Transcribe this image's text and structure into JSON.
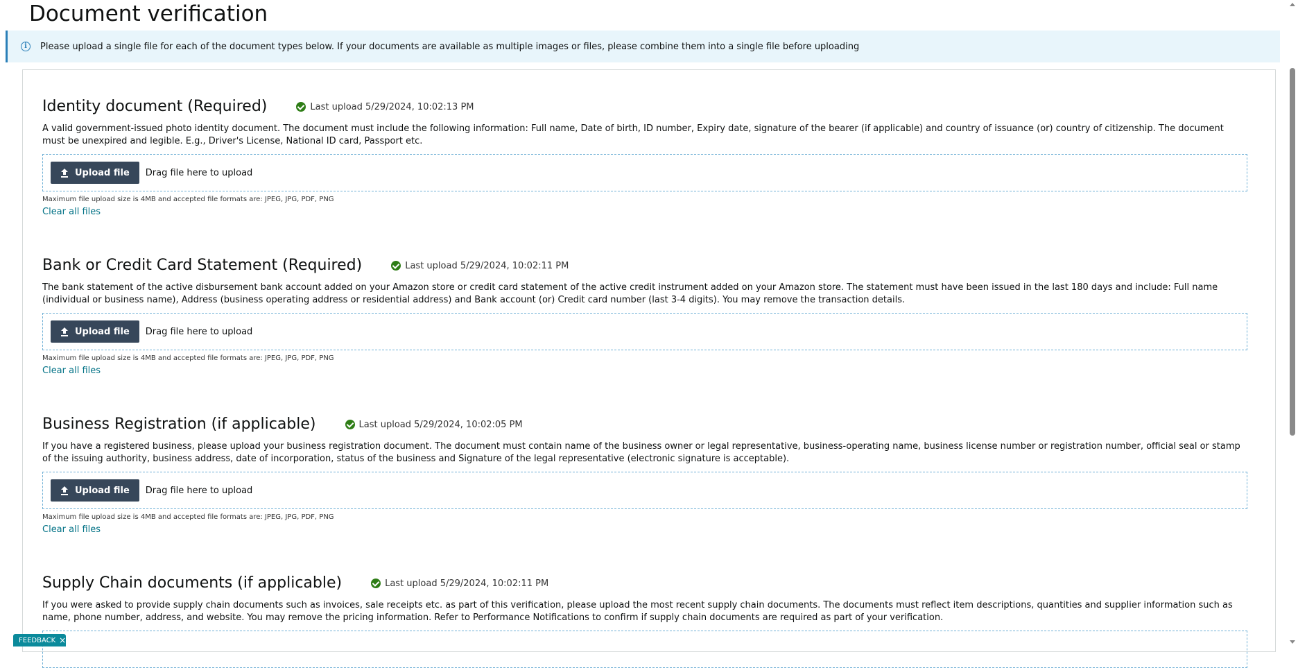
{
  "page": {
    "title": "Document verification"
  },
  "banner": {
    "text": "Please upload a single file for each of the document types below. If your documents are available as multiple images or files, please combine them into a single file before uploading"
  },
  "sections": [
    {
      "title": "Identity document (Required)",
      "status": "Last upload 5/29/2024, 10:02:13 PM",
      "description": "A valid government-issued photo identity document. The document must include the following information: Full name, Date of birth, ID number, Expiry date, signature of the bearer (if applicable) and country of issuance (or) country of citizenship. The document must be unexpired and legible. E.g., Driver's License, National ID card, Passport etc.",
      "upload_label": "Upload file",
      "drag_text": "Drag file here to upload",
      "hint": "Maximum file upload size is 4MB and accepted file formats are: JPEG, JPG, PDF, PNG",
      "clear_label": "Clear all files"
    },
    {
      "title": "Bank or Credit Card Statement (Required)",
      "status": "Last upload 5/29/2024, 10:02:11 PM",
      "description": "The bank statement of the active disbursement bank account added on your Amazon store or credit card statement of the active credit instrument added on your Amazon store. The statement must have been issued in the last 180 days and include: Full name (individual or business name), Address (business operating address or residential address) and Bank account (or) Credit card number (last 3-4 digits). You may remove the transaction details.",
      "upload_label": "Upload file",
      "drag_text": "Drag file here to upload",
      "hint": "Maximum file upload size is 4MB and accepted file formats are: JPEG, JPG, PDF, PNG",
      "clear_label": "Clear all files"
    },
    {
      "title": "Business Registration (if applicable)",
      "status": "Last upload 5/29/2024, 10:02:05 PM",
      "description": "If you have a registered business, please upload your business registration document. The document must contain name of the business owner or legal representative, business-operating name, business license number or registration number, official seal or stamp of the issuing authority, business address, date of incorporation, status of the business and Signature of the legal representative (electronic signature is acceptable).",
      "upload_label": "Upload file",
      "drag_text": "Drag file here to upload",
      "hint": "Maximum file upload size is 4MB and accepted file formats are: JPEG, JPG, PDF, PNG",
      "clear_label": "Clear all files"
    },
    {
      "title": "Supply Chain documents (if applicable)",
      "status": "Last upload 5/29/2024, 10:02:11 PM",
      "description": "If you were asked to provide supply chain documents such as invoices, sale receipts etc. as part of this verification, please upload the most recent supply chain documents. The documents must reflect item descriptions, quantities and supplier information such as name, phone number, address, and website. You may remove the pricing information. Refer to Performance Notifications to confirm if supply chain documents are required as part of your verification."
    }
  ],
  "feedback": {
    "label": "FEEDBACK",
    "close": "×"
  },
  "colors": {
    "link": "#007185",
    "button_bg": "#37475a",
    "success": "#2e7d16",
    "banner_bg": "#e8f5fb",
    "feedback_bg": "#0b8a9b"
  },
  "icons": [
    "info-icon",
    "check-circle-icon",
    "upload-icon",
    "close-icon"
  ]
}
